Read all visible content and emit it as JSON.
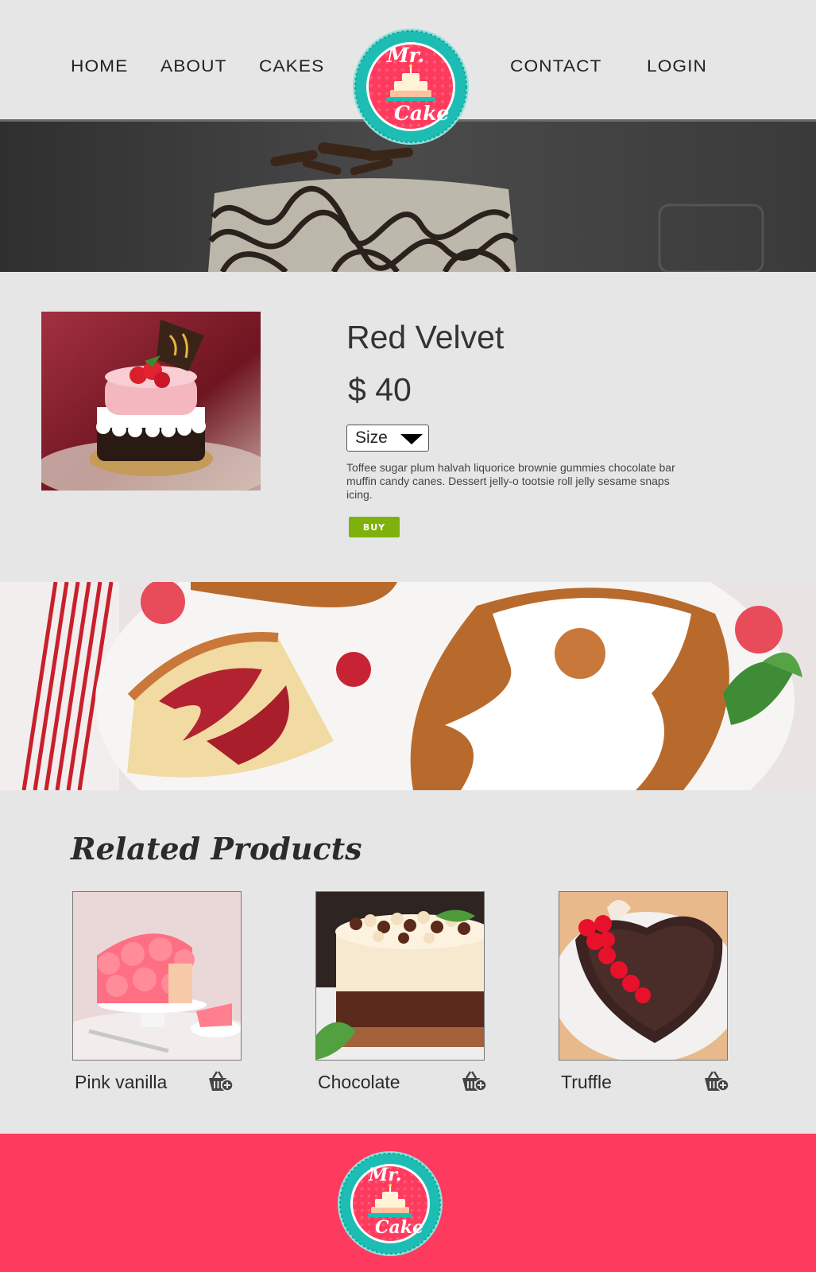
{
  "nav": {
    "items": [
      "HOME",
      "ABOUT",
      "CAKES",
      "CONTACT",
      "LOGIN"
    ]
  },
  "logo": {
    "line1": "Mr.",
    "line2": "Cake"
  },
  "product": {
    "title": "Red Velvet",
    "price": "$ 40",
    "size_label": "Size",
    "description": "Toffee sugar plum halvah liquorice brownie gummies chocolate bar muffin candy canes. Dessert jelly-o  tootsie roll jelly sesame snaps icing.",
    "buy_label": "BUY"
  },
  "related": {
    "heading": "Related Products",
    "items": [
      {
        "name": "Pink vanilla",
        "icon": "cart-add-icon"
      },
      {
        "name": "Chocolate",
        "icon": "cart-add-icon"
      },
      {
        "name": "Truffle",
        "icon": "cart-add-icon"
      }
    ]
  },
  "colors": {
    "background": "#e6e6e6",
    "brand_pink": "#fe3a5e",
    "logo_teal": "#1ebdb3",
    "buy_green": "#7fb10c",
    "text_dark": "#333333"
  }
}
